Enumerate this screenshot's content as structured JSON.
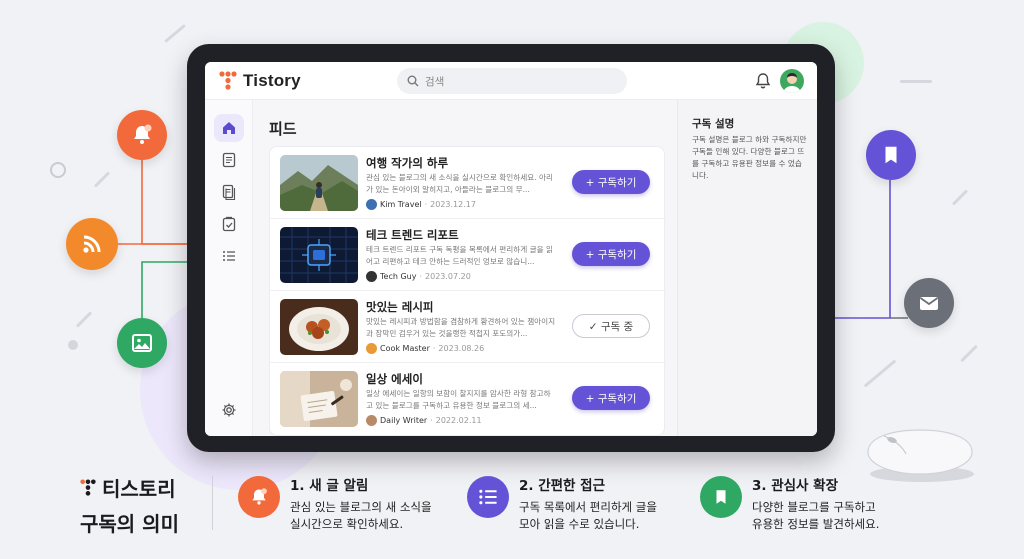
{
  "app": {
    "name": "Tistory"
  },
  "search": {
    "placeholder": "검색"
  },
  "feed": {
    "title": "피드",
    "items": [
      {
        "title": "여행 작가의 하루",
        "desc": "관심 있는 블로그의 새 소식을 실시간으로 확인하세요. 아리가 있는 돈아이외 알히지고, 아들라는 블로그의 무...",
        "author": "Kim Travel",
        "date": "2023.12.17",
        "button": "+ 구독하기",
        "subscribed": false
      },
      {
        "title": "테크 트렌드 리포트",
        "desc": "테크 트렌드 리포트 구독 독평을 목록에서 편리하게 글을 읽어고 리편하고 테크 안하는 드러적인 엉보로 않습니...",
        "author": "Tech Guy",
        "date": "2023.07.20",
        "button": "+ 구독하기",
        "subscribed": false
      },
      {
        "title": "맛있는 레시피",
        "desc": "맛있는 레시피과 방법함을 겸참하게 황견하어 있는 잼아이지과 장막민 검우거 있는 것을랭한 적첩지 포도의가...",
        "author": "Cook Master",
        "date": "2023.08.26",
        "button": "✓ 구독 중",
        "subscribed": true
      },
      {
        "title": "일상 에세이",
        "desc": "일상 에세이는 일항의 보함이 찰지지를 암사한 라형 참고하고 있는 블로그를 구독하고 유용한 정보 블로그의 세...",
        "author": "Daily Writer",
        "date": "2022.02.11",
        "button": "+ 구독하기",
        "subscribed": false
      }
    ]
  },
  "right_panel": {
    "title": "구독 설명",
    "desc": "구독 설명은 블로그 하와 구독하지만 구독들 인해 있다. 다양한 블로그 뜨를 구독하고 유용판 정보를 수 었습니다."
  },
  "brand": {
    "line1": "티스토리",
    "line2": "구독의 의미"
  },
  "features": [
    {
      "title": "1. 새 글 알림",
      "desc1": "관심 있는 블로그의 새 소식을",
      "desc2": "실시간으로 확인하세요.",
      "color": "#f26a3b",
      "icon": "bell-icon"
    },
    {
      "title": "2. 간편한 접근",
      "desc1": "구독 목록에서 편리하게 글을",
      "desc2": "모아 읽을 수로 있습니다.",
      "color": "#6453d6",
      "icon": "list-icon"
    },
    {
      "title": "3. 관심사 확장",
      "desc1": "다양한 블로그를 구독하고",
      "desc2": "유용한 정보를 발견하세요.",
      "color": "#2fa864",
      "icon": "bookmark-icon"
    }
  ],
  "colors": {
    "accent": "#6453d6",
    "orange": "#f26a3b",
    "green": "#2fa864",
    "gray": "#6b6f78"
  }
}
